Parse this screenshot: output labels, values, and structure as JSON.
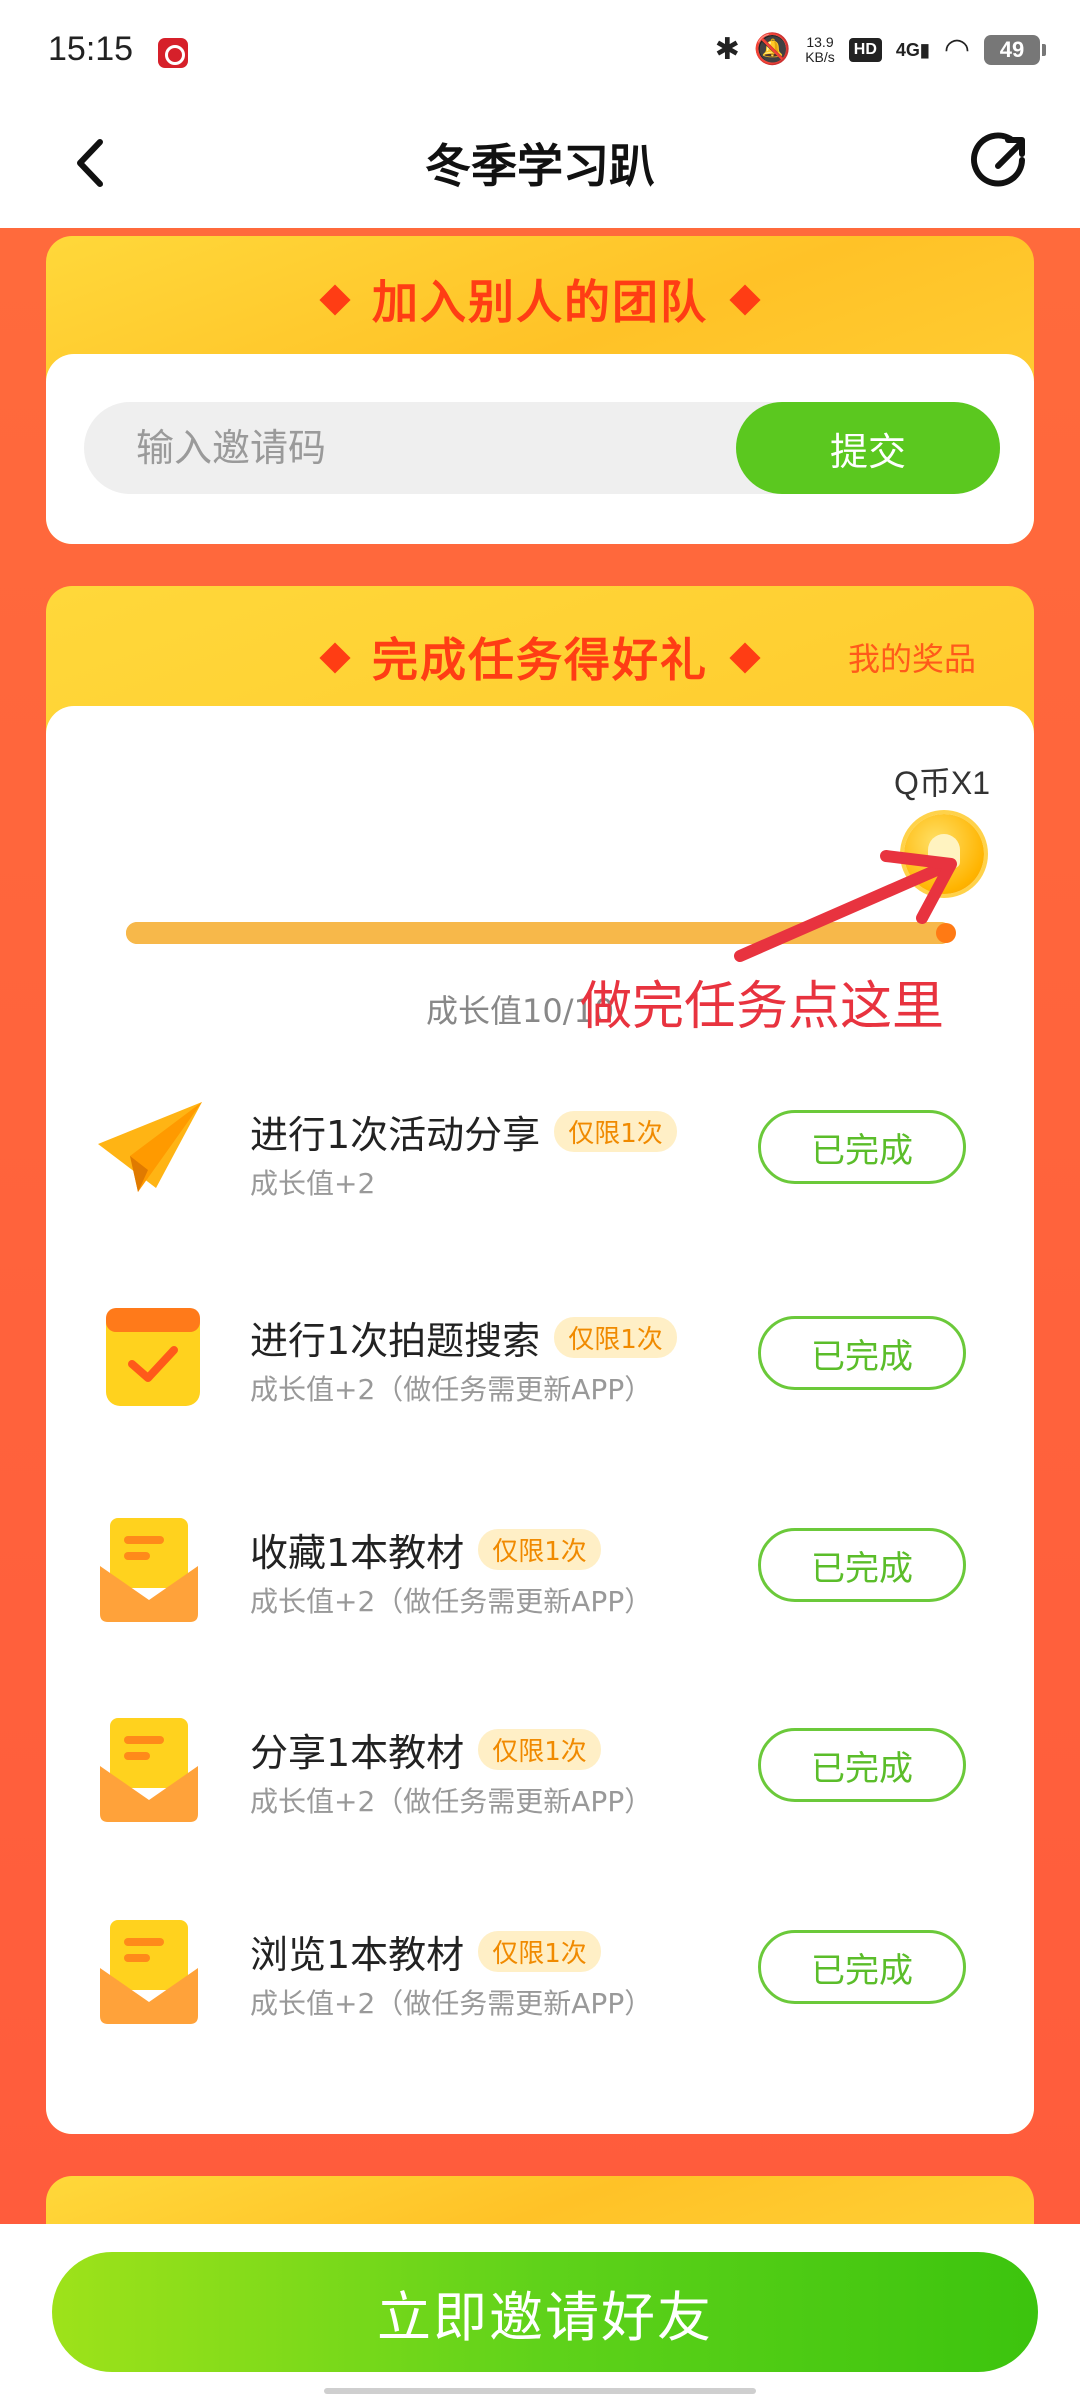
{
  "status_bar": {
    "time": "15:15",
    "net_speed_value": "13.9",
    "net_speed_unit": "KB/s",
    "hd_label": "HD",
    "network_label": "4G",
    "battery": "49",
    "icons": [
      "bluetooth-icon",
      "mute-icon",
      "signal-icon",
      "wifi-icon",
      "battery-icon"
    ]
  },
  "nav": {
    "title": "冬季学习趴",
    "back_icon": "chevron-left-icon",
    "share_icon": "share-icon"
  },
  "join_team": {
    "title": "加入别人的团队",
    "input_placeholder": "输入邀请码",
    "input_value": "",
    "submit_label": "提交"
  },
  "tasks_section": {
    "title": "完成任务得好礼",
    "my_prize_link": "我的奖品",
    "reward_label": "Q币X1",
    "progress": {
      "value": 10,
      "max": 10,
      "fraction": 1.0
    },
    "growth_label": "成长值10/10",
    "annotation": "做完任务点这里",
    "items": [
      {
        "title": "进行1次活动分享",
        "badge": "仅限1次",
        "subtitle": "成长值+2",
        "button": "已完成",
        "icon": "paper-plane-icon"
      },
      {
        "title": "进行1次拍题搜索",
        "badge": "仅限1次",
        "subtitle": "成长值+2（做任务需更新APP）",
        "button": "已完成",
        "icon": "calendar-check-icon"
      },
      {
        "title": "收藏1本教材",
        "badge": "仅限1次",
        "subtitle": "成长值+2（做任务需更新APP）",
        "button": "已完成",
        "icon": "envelope-icon"
      },
      {
        "title": "分享1本教材",
        "badge": "仅限1次",
        "subtitle": "成长值+2（做任务需更新APP）",
        "button": "已完成",
        "icon": "envelope-icon"
      },
      {
        "title": "浏览1本教材",
        "badge": "仅限1次",
        "subtitle": "成长值+2（做任务需更新APP）",
        "button": "已完成",
        "icon": "envelope-icon"
      }
    ]
  },
  "bottom": {
    "invite_button": "立即邀请好友"
  },
  "colors": {
    "page_bg": "#ff5a3c",
    "card_yellow": "#ffc227",
    "title_red": "#ff3d14",
    "green": "#5bc81f",
    "annotation_red": "#e8333f"
  }
}
